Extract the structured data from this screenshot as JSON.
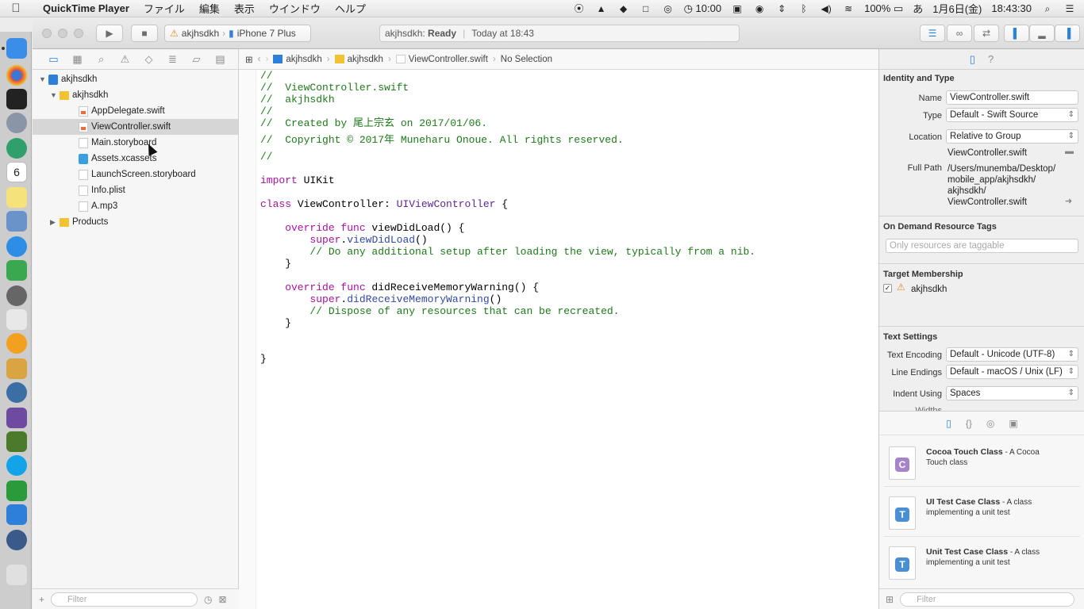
{
  "menubar": {
    "apple": "",
    "app_name": "QuickTime Player",
    "items": [
      "ファイル",
      "編集",
      "表示",
      "ウインドウ",
      "ヘルプ"
    ],
    "clock_extra": "10:00",
    "battery": "100%",
    "input_method": "あ",
    "date": "1月6日(金)",
    "time": "18:43:30"
  },
  "toolbar": {
    "scheme_project": "akjhsdkh",
    "scheme_device": "iPhone 7 Plus",
    "activity_project": "akjhsdkh:",
    "activity_status": "Ready",
    "activity_time": "Today at 18:43"
  },
  "navigator": {
    "tree": [
      {
        "label": "akjhsdkh",
        "kind": "project",
        "depth": 0,
        "disclosure": "▼"
      },
      {
        "label": "akjhsdkh",
        "kind": "folder",
        "depth": 1,
        "disclosure": "▼"
      },
      {
        "label": "AppDelegate.swift",
        "kind": "swift",
        "depth": 2
      },
      {
        "label": "ViewController.swift",
        "kind": "swift",
        "depth": 2,
        "selected": true
      },
      {
        "label": "Main.storyboard",
        "kind": "doc",
        "depth": 2
      },
      {
        "label": "Assets.xcassets",
        "kind": "assets",
        "depth": 2
      },
      {
        "label": "LaunchScreen.storyboard",
        "kind": "doc",
        "depth": 2
      },
      {
        "label": "Info.plist",
        "kind": "doc",
        "depth": 2
      },
      {
        "label": "A.mp3",
        "kind": "doc",
        "depth": 2
      },
      {
        "label": "Products",
        "kind": "folder",
        "depth": 1,
        "disclosure": "▶"
      }
    ],
    "filter_placeholder": "Filter"
  },
  "jumpbar": {
    "crumbs": [
      "akjhsdkh",
      "akjhsdkh",
      "ViewController.swift",
      "No Selection"
    ]
  },
  "code": {
    "lines": [
      [
        {
          "t": "//",
          "c": "comment"
        }
      ],
      [
        {
          "t": "//  ViewController.swift",
          "c": "comment"
        }
      ],
      [
        {
          "t": "//  akjhsdkh",
          "c": "comment"
        }
      ],
      [
        {
          "t": "//",
          "c": "comment"
        }
      ],
      [
        {
          "t": "//  Created by 尾上宗玄 on 2017/01/06.",
          "c": "comment"
        }
      ],
      [
        {
          "t": "//  Copyright © 2017年 Muneharu Onoue. All rights reserved.",
          "c": "comment"
        }
      ],
      [
        {
          "t": "//",
          "c": "comment"
        }
      ],
      [],
      [
        {
          "t": "import",
          "c": "keyword"
        },
        {
          "t": " UIKit",
          "c": "plain"
        }
      ],
      [],
      [
        {
          "t": "class",
          "c": "keyword"
        },
        {
          "t": " ViewController: ",
          "c": "plain"
        },
        {
          "t": "UIViewController",
          "c": "type"
        },
        {
          "t": " {",
          "c": "plain"
        }
      ],
      [],
      [
        {
          "t": "    override func",
          "c": "keyword"
        },
        {
          "t": " viewDidLoad() {",
          "c": "plain"
        }
      ],
      [
        {
          "t": "        super",
          "c": "keyword"
        },
        {
          "t": ".",
          "c": "plain"
        },
        {
          "t": "viewDidLoad",
          "c": "call"
        },
        {
          "t": "()",
          "c": "plain"
        }
      ],
      [
        {
          "t": "        // Do any additional setup after loading the view, typically from a nib.",
          "c": "comment"
        }
      ],
      [
        {
          "t": "    }",
          "c": "plain"
        }
      ],
      [],
      [
        {
          "t": "    override func",
          "c": "keyword"
        },
        {
          "t": " didReceiveMemoryWarning() {",
          "c": "plain"
        }
      ],
      [
        {
          "t": "        super",
          "c": "keyword"
        },
        {
          "t": ".",
          "c": "plain"
        },
        {
          "t": "didReceiveMemoryWarning",
          "c": "call"
        },
        {
          "t": "()",
          "c": "plain"
        }
      ],
      [
        {
          "t": "        // Dispose of any resources that can be recreated.",
          "c": "comment"
        }
      ],
      [
        {
          "t": "    }",
          "c": "plain"
        }
      ],
      [],
      [],
      [
        {
          "t": "}",
          "c": "plain"
        }
      ]
    ]
  },
  "inspector": {
    "identity_title": "Identity and Type",
    "name_label": "Name",
    "name_value": "ViewController.swift",
    "type_label": "Type",
    "type_value": "Default - Swift Source",
    "location_label": "Location",
    "location_value": "Relative to Group",
    "location_file": "ViewController.swift",
    "fullpath_label": "Full Path",
    "fullpath_lines": [
      "/Users/munemba/Desktop/",
      "mobile_app/akjhsdkh/",
      "akjhsdkh/",
      "ViewController.swift"
    ],
    "ondemand_title": "On Demand Resource Tags",
    "ondemand_placeholder": "Only resources are taggable",
    "membership_title": "Target Membership",
    "membership_target": "akjhsdkh",
    "text_title": "Text Settings",
    "encoding_label": "Text Encoding",
    "encoding_value": "Default - Unicode (UTF-8)",
    "endings_label": "Line Endings",
    "endings_value": "Default - macOS / Unix (LF)",
    "indent_label": "Indent Using",
    "indent_value": "Spaces",
    "widths_label": "Widths"
  },
  "library": {
    "items": [
      {
        "badge": "C",
        "badge_color": "#a684c9",
        "name": "Cocoa Touch Class",
        "desc": " - A Cocoa Touch class"
      },
      {
        "badge": "T",
        "badge_color": "#4a8fd4",
        "name": "UI Test Case Class",
        "desc": " - A class implementing a unit test"
      },
      {
        "badge": "T",
        "badge_color": "#4a8fd4",
        "name": "Unit Test Case Class",
        "desc": " - A class implementing a unit test"
      }
    ],
    "filter_placeholder": "Filter"
  },
  "dock": {
    "badge": "6"
  }
}
